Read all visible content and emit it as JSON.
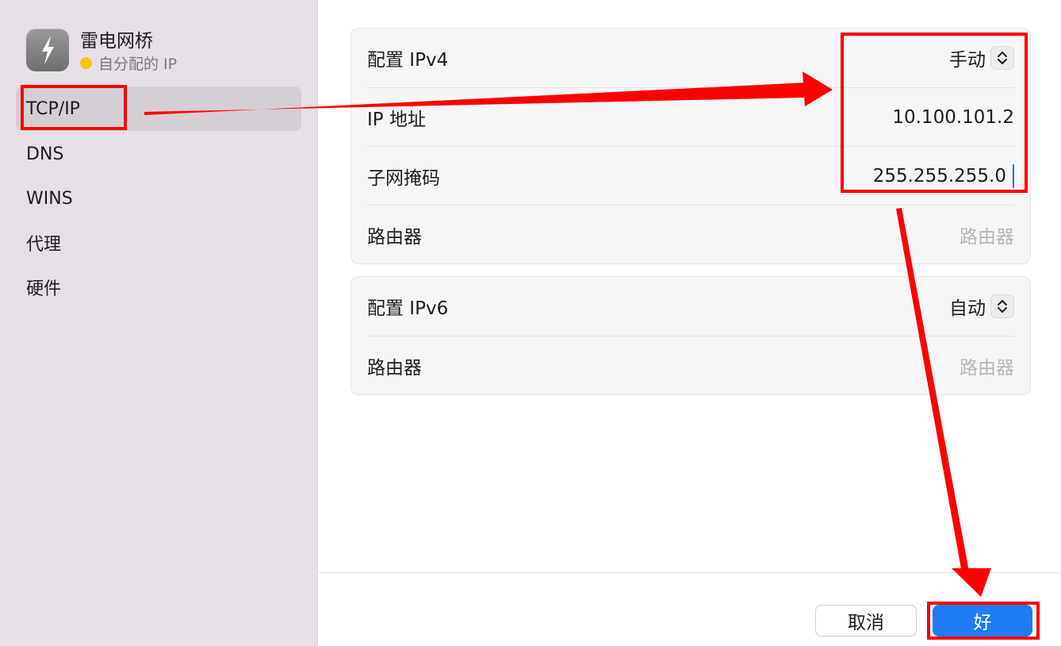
{
  "sidebar": {
    "app_title": "雷电网桥",
    "app_status": "自分配的 IP",
    "status_color": "#f5c612",
    "app_icon": "thunderbolt-bolt-icon",
    "items": [
      {
        "label": "TCP/IP",
        "selected": true
      },
      {
        "label": "DNS",
        "selected": false
      },
      {
        "label": "WINS",
        "selected": false
      },
      {
        "label": "代理",
        "selected": false
      },
      {
        "label": "硬件",
        "selected": false
      }
    ]
  },
  "ipv4": {
    "configure_label": "配置 IPv4",
    "configure_value": "手动",
    "ip_label": "IP 地址",
    "ip_value": "10.100.101.2",
    "subnet_label": "子网掩码",
    "subnet_value": "255.255.255.0",
    "router_label": "路由器",
    "router_placeholder": "路由器"
  },
  "ipv6": {
    "configure_label": "配置 IPv6",
    "configure_value": "自动",
    "router_label": "路由器",
    "router_placeholder": "路由器"
  },
  "footer": {
    "cancel_label": "取消",
    "ok_label": "好"
  },
  "colors": {
    "accent": "#1f7cf6",
    "annotation": "#ff0000",
    "sidebar_bg": "#e6dfe6"
  }
}
